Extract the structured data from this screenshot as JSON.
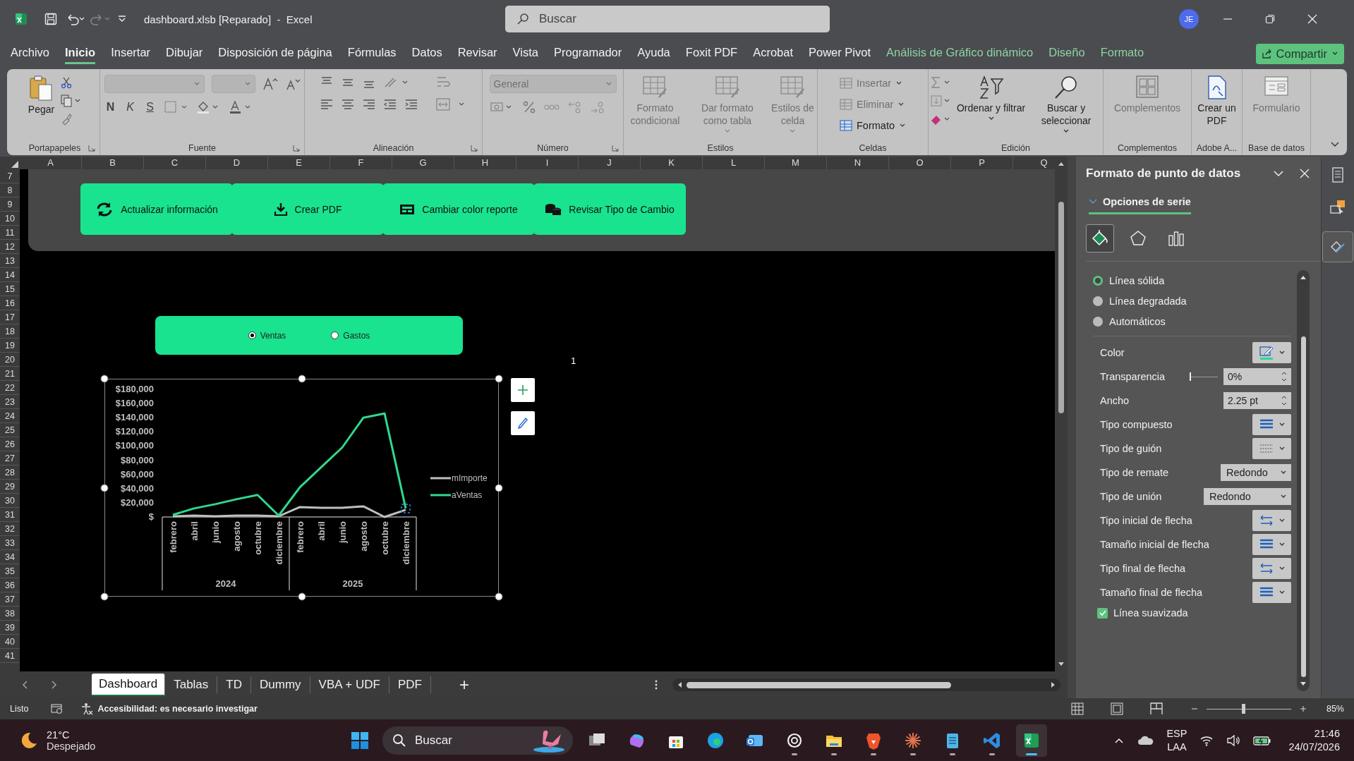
{
  "title_bar": {
    "file_title": "dashboard.xlsb [Reparado]  -  Excel",
    "search_placeholder": "Buscar",
    "user_initials": "JE"
  },
  "menu_tabs": [
    {
      "label": "Archivo",
      "selected": false,
      "kind": "normal"
    },
    {
      "label": "Inicio",
      "selected": true,
      "kind": "normal"
    },
    {
      "label": "Insertar",
      "selected": false,
      "kind": "normal"
    },
    {
      "label": "Dibujar",
      "selected": false,
      "kind": "normal"
    },
    {
      "label": "Disposición de página",
      "selected": false,
      "kind": "normal"
    },
    {
      "label": "Fórmulas",
      "selected": false,
      "kind": "normal"
    },
    {
      "label": "Datos",
      "selected": false,
      "kind": "normal"
    },
    {
      "label": "Revisar",
      "selected": false,
      "kind": "normal"
    },
    {
      "label": "Vista",
      "selected": false,
      "kind": "normal"
    },
    {
      "label": "Programador",
      "selected": false,
      "kind": "normal"
    },
    {
      "label": "Ayuda",
      "selected": false,
      "kind": "normal"
    },
    {
      "label": "Foxit PDF",
      "selected": false,
      "kind": "normal"
    },
    {
      "label": "Acrobat",
      "selected": false,
      "kind": "normal"
    },
    {
      "label": "Power Pivot",
      "selected": false,
      "kind": "normal"
    },
    {
      "label": "Análisis de Gráfico dinámico",
      "selected": false,
      "kind": "contextual"
    },
    {
      "label": "Diseño",
      "selected": false,
      "kind": "contextual"
    },
    {
      "label": "Formato",
      "selected": false,
      "kind": "contextual"
    }
  ],
  "share_button": "Compartir",
  "ribbon": {
    "groups": [
      {
        "label": "Portapapeles",
        "buttons": [
          {
            "label": "Pegar",
            "disabled": false
          }
        ]
      },
      {
        "label": "Fuente",
        "glyph_buttons": [
          "N",
          "K",
          "S"
        ]
      },
      {
        "label": "Alineación"
      },
      {
        "label": "Número",
        "format_value": "General"
      },
      {
        "label": "Estilos",
        "buttons": [
          {
            "label": "Formato condicional",
            "disabled": true
          },
          {
            "label": "Dar formato como tabla",
            "disabled": true
          },
          {
            "label": "Estilos de celda",
            "disabled": true
          }
        ]
      },
      {
        "label": "Celdas",
        "buttons": [
          {
            "label": "Insertar",
            "disabled": true
          },
          {
            "label": "Eliminar",
            "disabled": true
          },
          {
            "label": "Formato",
            "disabled": false
          }
        ]
      },
      {
        "label": "Edición",
        "buttons": [
          {
            "label": "Ordenar y filtrar",
            "disabled": false
          },
          {
            "label": "Buscar y seleccionar",
            "disabled": false
          }
        ]
      },
      {
        "label": "Complementos",
        "buttons": [
          {
            "label": "Complementos",
            "disabled": true
          }
        ]
      },
      {
        "label": "Adobe A...",
        "buttons": [
          {
            "label": "Crear un PDF",
            "disabled": false
          }
        ]
      },
      {
        "label": "Base de datos",
        "buttons": [
          {
            "label": "Formulario",
            "disabled": true
          }
        ]
      }
    ]
  },
  "sheet": {
    "columns": [
      "A",
      "B",
      "C",
      "D",
      "E",
      "F",
      "G",
      "H",
      "I",
      "J",
      "K",
      "L",
      "M",
      "N",
      "O",
      "P",
      "Q"
    ],
    "rows": [
      "7",
      "8",
      "9",
      "10",
      "11",
      "12",
      "13",
      "14",
      "15",
      "16",
      "17",
      "18",
      "19",
      "20",
      "21",
      "22",
      "23",
      "24",
      "25",
      "26",
      "27",
      "28",
      "29",
      "30",
      "31",
      "32",
      "33",
      "34",
      "35",
      "36",
      "37",
      "38",
      "39",
      "40",
      "41"
    ],
    "action_buttons": [
      "Actualizar información",
      "Crear PDF",
      "Cambiar color reporte",
      "Revisar Tipo de Cambio"
    ],
    "options": [
      {
        "label": "Ventas",
        "selected": true
      },
      {
        "label": "Gastos",
        "selected": false
      }
    ],
    "cell_value": "1",
    "chart": {
      "year_labels": [
        "2024",
        "2025"
      ],
      "chart_data": {
        "type": "line",
        "legend": "right",
        "categories": [
          "febrero",
          "abril",
          "junio",
          "agosto",
          "octubre",
          "diciembre",
          "febrero",
          "abril",
          "junio",
          "agosto",
          "octubre",
          "diciembre"
        ],
        "series": [
          {
            "name": "mImporte",
            "color": "#bfbfbf",
            "values": [
              1000,
              2000,
              1000,
              2000,
              2000,
              1000,
              14000,
              13000,
              13000,
              15000,
              0,
              10000
            ]
          },
          {
            "name": "aVentas",
            "color": "#2fd98c",
            "values": [
              3000,
              12000,
              18000,
              25000,
              31000,
              2000,
              42000,
              70000,
              98000,
              140000,
              146000,
              12000
            ]
          }
        ],
        "ylim": [
          0,
          180000
        ],
        "yticks": [
          {
            "value": 0,
            "label": "$"
          },
          {
            "value": 20000,
            "label": "$20,000"
          },
          {
            "value": 40000,
            "label": "$40,000"
          },
          {
            "value": 60000,
            "label": "$60,000"
          },
          {
            "value": 80000,
            "label": "$80,000"
          },
          {
            "value": 100000,
            "label": "$100,000"
          },
          {
            "value": 120000,
            "label": "$120,000"
          },
          {
            "value": 140000,
            "label": "$140,000"
          },
          {
            "value": 160000,
            "label": "$160,000"
          },
          {
            "value": 180000,
            "label": "$180,000"
          }
        ]
      }
    }
  },
  "sheet_tabs": [
    {
      "label": "Dashboard",
      "selected": true
    },
    {
      "label": "Tablas",
      "selected": false
    },
    {
      "label": "TD",
      "selected": false
    },
    {
      "label": "Dummy",
      "selected": false
    },
    {
      "label": "VBA + UDF",
      "selected": false
    },
    {
      "label": "PDF",
      "selected": false
    }
  ],
  "add_sheet": "+",
  "format_pane": {
    "title": "Formato de punto de datos",
    "section": "Opciones de serie",
    "section_expanded": true,
    "category_tabs": [
      {
        "selected": true
      },
      {
        "selected": false
      },
      {
        "selected": false
      }
    ],
    "line_options": [
      {
        "label": "Línea sólida",
        "selected": true
      },
      {
        "label": "Línea degradada",
        "selected": false
      },
      {
        "label": "Automáticos",
        "selected": false
      }
    ],
    "properties": [
      {
        "label": "Color",
        "kind": "color",
        "color": "#2fd98c"
      },
      {
        "label": "Transparencia",
        "kind": "slider",
        "value": "0%",
        "level": 0
      },
      {
        "label": "Ancho",
        "kind": "spin",
        "value": "2.25 pt"
      },
      {
        "label": "Tipo compuesto",
        "kind": "lines"
      },
      {
        "label": "Tipo de guión",
        "kind": "dash"
      },
      {
        "label": "Tipo de remate",
        "kind": "dropdown",
        "value": "Redondo"
      },
      {
        "label": "Tipo de unión",
        "kind": "dropdown",
        "value": "Redondo"
      },
      {
        "label": "Tipo inicial de flecha",
        "kind": "arrows"
      },
      {
        "label": "Tamaño inicial de flecha",
        "kind": "lines"
      },
      {
        "label": "Tipo final de flecha",
        "kind": "arrows"
      },
      {
        "label": "Tamaño final de flecha",
        "kind": "lines"
      }
    ],
    "smooth_line": {
      "label": "Línea suavizada",
      "checked": true
    }
  },
  "status_bar": {
    "ready": "Listo",
    "accessibility": "Accesibilidad: es necesario investigar",
    "zoom": "85%",
    "zoom_level": {
      "level": 0.42
    }
  },
  "taskbar": {
    "weather": {
      "temperature": "21°C",
      "condition": "Despejado"
    },
    "search_placeholder": "Buscar",
    "apps": [
      {
        "running": false,
        "selected": false
      },
      {
        "running": false,
        "selected": false
      },
      {
        "running": false,
        "selected": false
      },
      {
        "running": false,
        "selected": false
      },
      {
        "running": false,
        "selected": false
      },
      {
        "running": true,
        "selected": false
      },
      {
        "running": true,
        "selected": false
      },
      {
        "running": true,
        "selected": false
      },
      {
        "running": true,
        "selected": false
      },
      {
        "running": true,
        "selected": false
      },
      {
        "running": true,
        "selected": false
      },
      {
        "running": true,
        "selected": true
      }
    ],
    "language": "ESP",
    "layout": "LAA",
    "time": "21:46",
    "date": "24/07/2026"
  }
}
